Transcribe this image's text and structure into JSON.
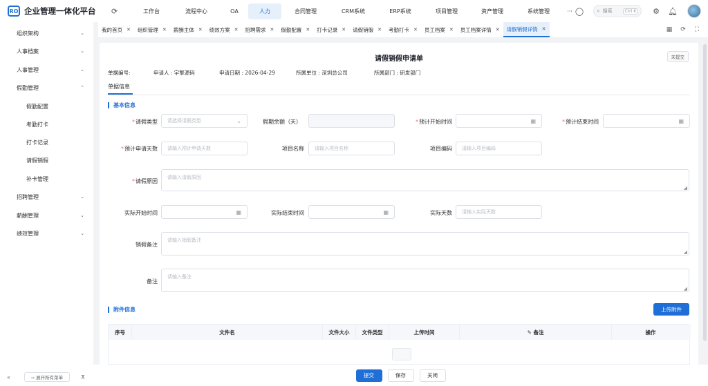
{
  "app": {
    "logo_text": "RO",
    "title": "企业管理一体化平台"
  },
  "topnav": [
    "工作台",
    "流程中心",
    "OA",
    "人力",
    "合同管理",
    "CRM系统",
    "ERP系统",
    "项目管理",
    "资产管理",
    "系统管理",
    "···"
  ],
  "topnav_active_index": 3,
  "search": {
    "placeholder": "搜索",
    "shortcut": "Ctrl K"
  },
  "sidebar": {
    "items": [
      {
        "label": "组织架构",
        "chev": "⌄"
      },
      {
        "label": "人事档案",
        "chev": "⌄"
      },
      {
        "label": "人事管理",
        "chev": "⌄"
      },
      {
        "label": "假勤管理",
        "chev": "⌃"
      },
      {
        "label": "假勤配置",
        "chev": ""
      },
      {
        "label": "考勤打卡",
        "chev": ""
      },
      {
        "label": "打卡记录",
        "chev": ""
      },
      {
        "label": "请假销假",
        "chev": ""
      },
      {
        "label": "补卡管理",
        "chev": ""
      },
      {
        "label": "招聘管理",
        "chev": "⌄"
      },
      {
        "label": "薪酬管理",
        "chev": "⌄"
      },
      {
        "label": "绩效管理",
        "chev": "⌄"
      }
    ],
    "expand_all": "‹› 展开所有菜单"
  },
  "tabs": [
    "我的首页",
    "组织管理",
    "薪酬主体",
    "绩效方案",
    "招聘需求",
    "假勤配置",
    "打卡记录",
    "请假销假",
    "考勤打卡",
    "员工档案",
    "员工档案详情",
    "请假销假详情"
  ],
  "tabs_active_index": 11,
  "form": {
    "title": "请假销假申请单",
    "status": "未提交",
    "meta": {
      "doc_no": "单据编号:",
      "applicant": "申请人 : 宇擎源码",
      "date": "申请日期 : 2026-04-29",
      "unit": "所属单位 : 深圳总公司",
      "dept": "所属部门 : 研发部门"
    },
    "subtab": "单据信息",
    "section_basic": "基本信息",
    "fields": {
      "leave_type": {
        "label": "请假类型",
        "placeholder": "请选择请假类型"
      },
      "leave_balance": {
        "label": "假期余额（天）",
        "placeholder": ""
      },
      "plan_start": {
        "label": "预计开始时间",
        "placeholder": ""
      },
      "plan_end": {
        "label": "预计结束时间",
        "placeholder": ""
      },
      "plan_days": {
        "label": "预计申请天数",
        "placeholder": "请输入预计申请天数"
      },
      "project_name": {
        "label": "项目名称",
        "placeholder": "请输入项目名称"
      },
      "project_code": {
        "label": "项目编码",
        "placeholder": "请输入项目编码"
      },
      "reason": {
        "label": "请假原因",
        "placeholder": "请输入请假原因"
      },
      "actual_start": {
        "label": "实际开始时间",
        "placeholder": ""
      },
      "actual_end": {
        "label": "实际结束时间",
        "placeholder": ""
      },
      "actual_days": {
        "label": "实际天数",
        "placeholder": "请输入实际天数"
      },
      "cancel_note": {
        "label": "销假备注",
        "placeholder": "请输入销假备注"
      },
      "note": {
        "label": "备注",
        "placeholder": "请输入备注"
      }
    },
    "section_attach": "附件信息",
    "upload_label": "上传附件",
    "table_columns": [
      "序号",
      "文件名",
      "文件大小",
      "文件类型",
      "上传时间",
      "✎ 备注",
      "操作"
    ]
  },
  "actions": {
    "submit": "提交",
    "save": "保存",
    "close": "关闭"
  },
  "colors": {
    "accent": "#1f6fd6",
    "required": "#f56c6c"
  }
}
